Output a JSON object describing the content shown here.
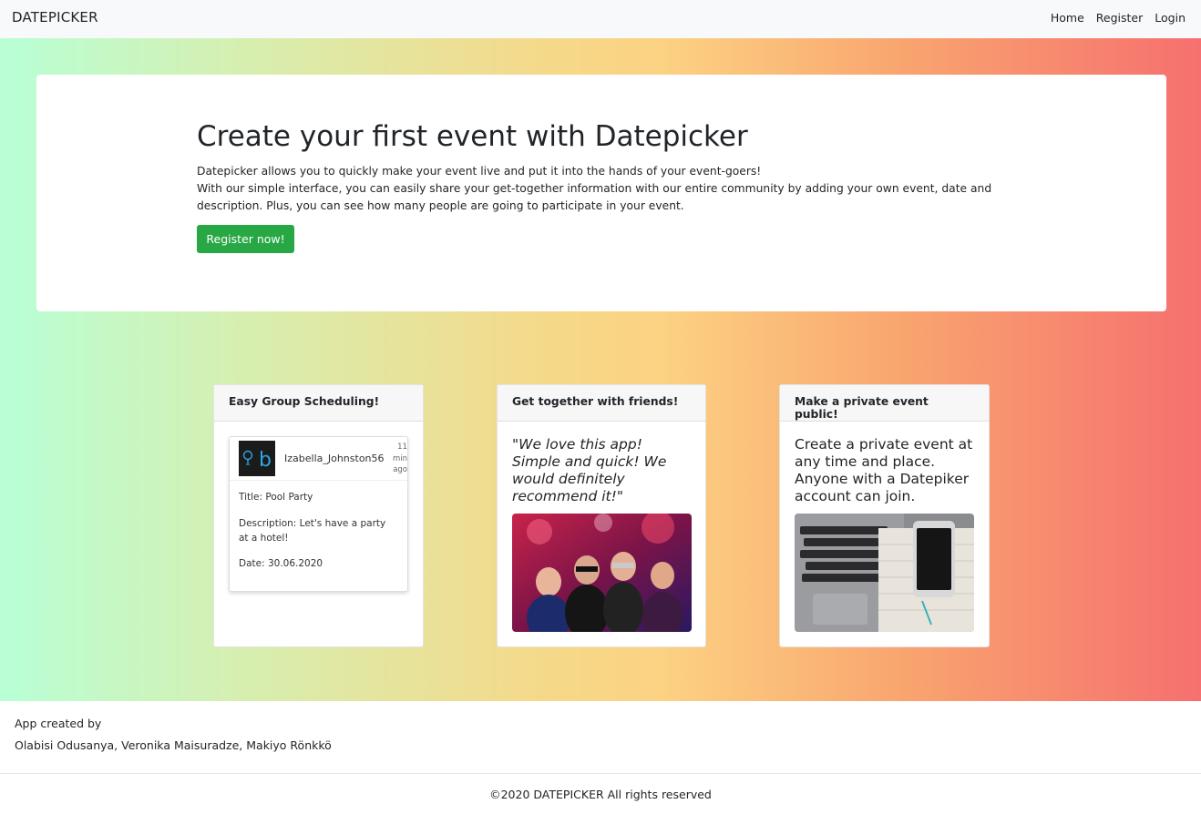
{
  "navbar": {
    "brand": "DATEPICKER",
    "links": [
      "Home",
      "Register",
      "Login"
    ]
  },
  "hero": {
    "title": "Create your first event with Datepicker",
    "line1": "Datepicker allows you to quickly make your event live and put it into the hands of your event-goers!",
    "line2": "With our simple interface, you can easily share your get-together information with our entire community by adding your own event, date and description. Plus, you can see how many people are going to participate in your event.",
    "button": "Register now!"
  },
  "cards": [
    {
      "header": "Easy Group Scheduling!",
      "post": {
        "username": "Izabella_Johnston56",
        "time_ago": "11 min ago",
        "title": "Title: Pool Party",
        "description": "Description: Let's have a party at a hotel!",
        "date": "Date: 30.06.2020"
      }
    },
    {
      "header": "Get together with friends!",
      "quote": "\"We love this app! Simple and quick! We would definitely recommend it!\"",
      "image_icon": "party-photo"
    },
    {
      "header": "Make a private event public!",
      "text": "Create a private event at any time and place. Anyone with a Datepiker account can join.",
      "image_icon": "laptop-phone-photo"
    }
  ],
  "footer": {
    "created_by": "App created by",
    "authors": "Olabisi Odusanya, Veronika Maisuradze, Makiyo Rönkkö",
    "copyright": "©2020 DATEPICKER All rights reserved"
  },
  "colors": {
    "navbar_bg": "#f8f9fa",
    "button_green": "#28a745",
    "gradient_start": "#b8ffd6",
    "gradient_end": "#f6706f"
  }
}
